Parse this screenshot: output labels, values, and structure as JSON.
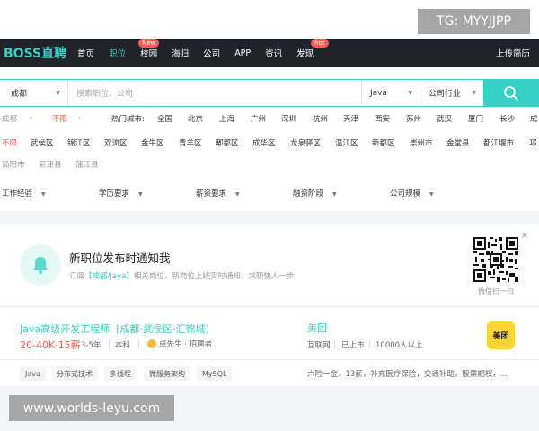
{
  "watermark_top": "TG: MYYJJPP",
  "watermark_bottom": "www.worlds-leyu.com",
  "nav": {
    "logo": "BOSS直聘",
    "items": [
      {
        "label": "首页"
      },
      {
        "label": "职位",
        "active": true
      },
      {
        "label": "校园",
        "badge": "New"
      },
      {
        "label": "海归"
      },
      {
        "label": "公司"
      },
      {
        "label": "APP"
      },
      {
        "label": "资讯"
      },
      {
        "label": "发现",
        "badge": "hot"
      }
    ],
    "right": "上传简历"
  },
  "search": {
    "city": "成都",
    "placeholder": "搜索职位、公司",
    "keyword_select": "Java",
    "industry_select": "公司行业"
  },
  "filters": {
    "city_label": "成都",
    "hot_prefix": "不限",
    "hot_label": "热门城市:",
    "hot_cities": [
      "全国",
      "北京",
      "上海",
      "广州",
      "深圳",
      "杭州",
      "天津",
      "西安",
      "苏州",
      "武汉",
      "厦门",
      "长沙",
      "成"
    ],
    "districts_row1": [
      "不限",
      "武侯区",
      "锦江区",
      "双流区",
      "金牛区",
      "青羊区",
      "郫都区",
      "成华区",
      "龙泉驿区",
      "温江区",
      "新都区",
      "崇州市",
      "金堂县",
      "都江堰市",
      "邛"
    ],
    "districts_row2": [
      "简阳市",
      "新津县",
      "蒲江县"
    ],
    "conditions": [
      "工作经验",
      "学历要求",
      "薪资要求",
      "融资阶段",
      "公司规模"
    ]
  },
  "subscribe": {
    "title": "新职位发布时通知我",
    "desc_prefix": "订阅",
    "desc_highlight": "【成都/Java】",
    "desc_suffix": "相关岗位，新岗位上线实时通知，求职快人一步",
    "qr_label": "微信扫一扫",
    "close": "×"
  },
  "job": {
    "title": "Java高级开发工程师",
    "location": "[成都·武侯区·汇锦城]",
    "salary": "20-40K·15薪",
    "experience": "3-5年",
    "education": "本科",
    "recruiter": "卓先生 · 招聘者",
    "company": "美团",
    "industry": "互联网",
    "stage": "已上市",
    "size": "10000人以上",
    "logo_text": "美团",
    "tags": [
      "Java",
      "分布式技术",
      "多线程",
      "微服务架构",
      "MySQL"
    ],
    "benefits": "六险一金，13薪，补充医疗保险，交通补助，股票期权，..."
  }
}
